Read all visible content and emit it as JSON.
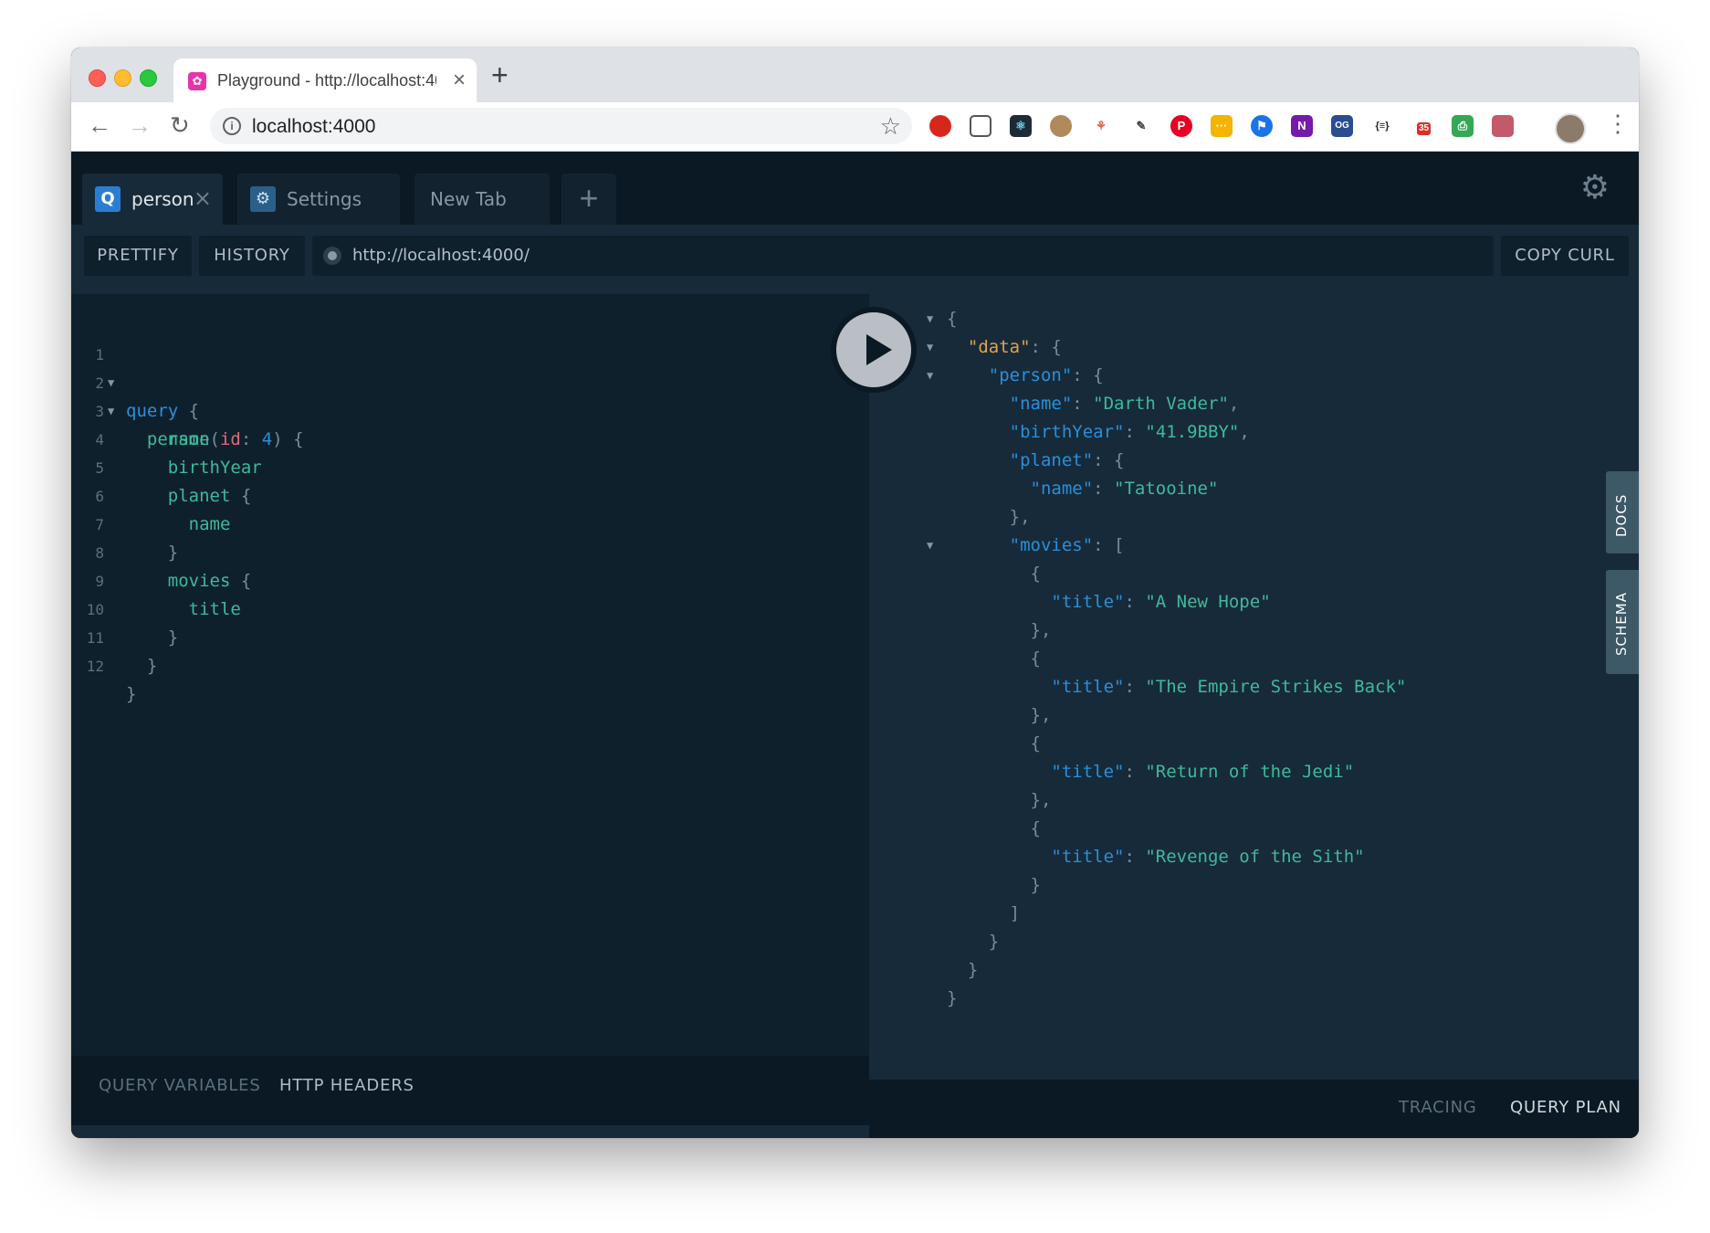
{
  "browser": {
    "tab_title": "Playground - http://localhost:4000",
    "url": "localhost:4000",
    "extensions": [
      "ublock-icon",
      "pocket-icon",
      "react-icon",
      "cookie-icon",
      "network-icon",
      "eyedropper-icon",
      "pinterest-icon",
      "ext-yellow-icon",
      "bookmark-icon",
      "onenote-icon",
      "og-icon",
      "json-icon",
      "ext-badge-icon",
      "print-icon",
      "photo-icon"
    ],
    "ext_badge": "35",
    "json_ext_label": "{≡}",
    "og_label": "OG"
  },
  "playground": {
    "tabs": [
      {
        "label": "person",
        "badge": "Q",
        "active": true
      },
      {
        "label": "Settings",
        "active": false
      },
      {
        "label": "New Tab",
        "active": false
      }
    ],
    "controls": {
      "prettify": "PRETTIFY",
      "history": "HISTORY",
      "endpoint": "http://localhost:4000/",
      "copy_curl": "COPY CURL"
    },
    "editor_lines": [
      {
        "n": "1",
        "fold": true
      },
      {
        "n": "2",
        "fold": true
      },
      {
        "n": "3"
      },
      {
        "n": "4"
      },
      {
        "n": "5"
      },
      {
        "n": "6"
      },
      {
        "n": "7"
      },
      {
        "n": "8"
      },
      {
        "n": "9"
      },
      {
        "n": "10"
      },
      {
        "n": "11"
      },
      {
        "n": "12"
      }
    ],
    "query": {
      "keyword": "query",
      "field": "person",
      "arg_name": "id",
      "arg_value": "4",
      "name": "name",
      "birthYear": "birthYear",
      "planet": "planet",
      "planet_name": "name",
      "movies": "movies",
      "title": "title"
    },
    "result": {
      "data_key": "\"data\"",
      "person_key": "\"person\"",
      "name_key": "\"name\"",
      "name_val": "\"Darth Vader\"",
      "birth_key": "\"birthYear\"",
      "birth_val": "\"41.9BBY\"",
      "planet_key": "\"planet\"",
      "planet_name_key": "\"name\"",
      "planet_name_val": "\"Tatooine\"",
      "movies_key": "\"movies\"",
      "title_key": "\"title\"",
      "movies": [
        "\"A New Hope\"",
        "\"The Empire Strikes Back\"",
        "\"Return of the Jedi\"",
        "\"Revenge of the Sith\""
      ]
    },
    "side_tabs": {
      "docs": "DOCS",
      "schema": "SCHEMA"
    },
    "bottom_left": {
      "query_variables": "QUERY VARIABLES",
      "http_headers": "HTTP HEADERS"
    },
    "bottom_right": {
      "tracing": "TRACING",
      "query_plan": "QUERY PLAN"
    }
  }
}
